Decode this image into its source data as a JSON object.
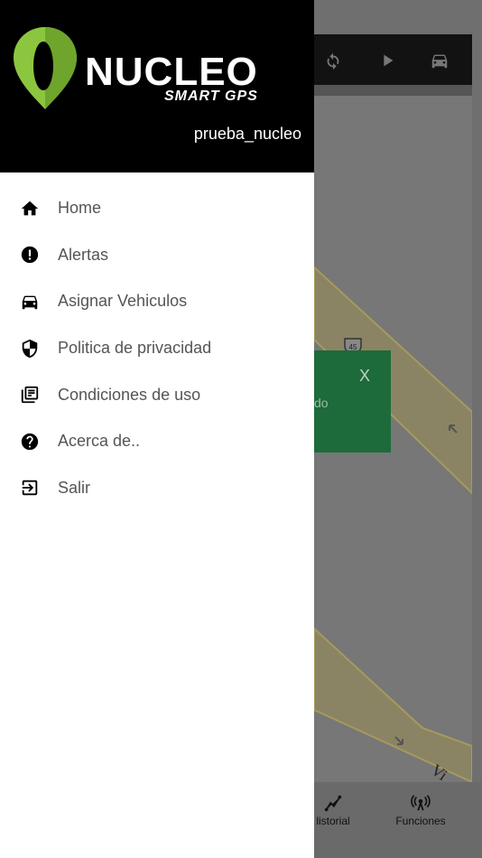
{
  "background_app": {
    "toolbar": {
      "icons": [
        "refresh-icon",
        "play-icon",
        "car-icon"
      ]
    },
    "toast": {
      "close_label": "X",
      "text_fragment": "do"
    },
    "map": {
      "highway_shield": "45",
      "street_fragment": "Vi"
    },
    "tabbar": {
      "tabs": [
        {
          "label": "Historial",
          "visible_label": "listorial",
          "icon": "route-icon"
        },
        {
          "label": "Funciones",
          "icon": "antenna-icon"
        }
      ]
    }
  },
  "drawer": {
    "brand": {
      "name": "NUCLEO",
      "tagline": "SMART GPS",
      "pin_color": "#8cc63f"
    },
    "username": "prueba_nucleo",
    "menu": [
      {
        "label": "Home",
        "icon": "home-icon"
      },
      {
        "label": "Alertas",
        "icon": "alert-icon"
      },
      {
        "label": "Asignar Vehiculos",
        "icon": "car-icon"
      },
      {
        "label": "Politica de privacidad",
        "icon": "shield-icon"
      },
      {
        "label": "Condiciones de uso",
        "icon": "library-icon"
      },
      {
        "label": "Acerca de..",
        "icon": "help-icon"
      },
      {
        "label": "Salir",
        "icon": "logout-icon"
      }
    ]
  },
  "colors": {
    "drawer_bg": "#ffffff",
    "header_bg": "#000000",
    "overlay": "#6f6f6f",
    "menu_text": "#555555",
    "toast_bg": "#1d6b3a",
    "road": "#b8ab6a"
  }
}
